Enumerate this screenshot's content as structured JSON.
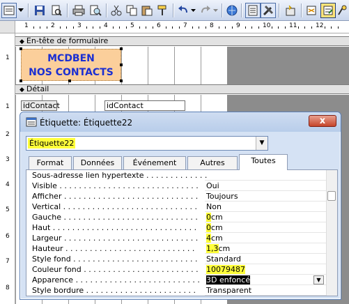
{
  "design_view": {
    "header_section_label": "En-tête de formulaire",
    "detail_section_label": "Détail",
    "header_label_line1": "MCDBEN",
    "header_label_line2": "NOS CONTACTS",
    "detail_label": "idContact",
    "detail_textbox": "idContact",
    "ruler_numbers": [
      "1",
      "2",
      "3",
      "4",
      "5",
      "6",
      "7",
      "8",
      "9",
      "10",
      "11",
      "12"
    ],
    "vruler_numbers": [
      "1",
      "1",
      "2",
      "3",
      "4",
      "5",
      "6",
      "7",
      "8"
    ]
  },
  "dialog": {
    "title": "Étiquette: Étiquette22",
    "close_label": "x",
    "selected_object": "Étiquette22",
    "tabs": [
      "Format",
      "Données",
      "Événement",
      "Autres",
      "Toutes"
    ],
    "active_tab": "Toutes",
    "properties": [
      {
        "name": "Sous-adresse lien hypertexte . . . . . . . . . . . . . . .",
        "value": ""
      },
      {
        "name": "Visible . . . . . . . . . . . . . . . . . . . . . . . . . . . . .",
        "value": "Oui"
      },
      {
        "name": "Afficher . . . . . . . . . . . . . . . . . . . . . . . . . . . .",
        "value": "Toujours"
      },
      {
        "name": "Vertical . . . . . . . . . . . . . . . . . . . . . . . . . . . .",
        "value": "Non"
      },
      {
        "name": "Gauche . . . . . . . . . . . . . . . . . . . . . . . . . . . .",
        "value": "0cm",
        "hl": "0"
      },
      {
        "name": "Haut . . . . . . . . . . . . . . . . . . . . . . . . . . . . . .",
        "value": "0cm",
        "hl": "0"
      },
      {
        "name": "Largeur . . . . . . . . . . . . . . . . . . . . . . . . . . . .",
        "value": "4cm",
        "hl": "4"
      },
      {
        "name": "Hauteur . . . . . . . . . . . . . . . . . . . . . . . . . . .",
        "value": "1,3cm",
        "hl": "1,3"
      },
      {
        "name": "Style fond . . . . . . . . . . . . . . . . . . . . . . . . . .",
        "value": "Standard"
      },
      {
        "name": "Couleur fond . . . . . . . . . . . . . . . . . . . . . . . .",
        "value": "10079487",
        "hl": "10079487"
      },
      {
        "name": "Apparence . . . . . . . . . . . . . . . . . . . . . . . . . .",
        "value": "3D enfoncé",
        "selected": true
      },
      {
        "name": "Style bordure . . . . . . . . . . . . . . . . . . . . . . .",
        "value": "Transparent"
      }
    ]
  },
  "colors": {
    "highlight": "#ffff3a",
    "label_bg": "#fbcf9b",
    "label_text": "#1b2fd2"
  },
  "toolbar_icons": [
    "form-view-icon",
    "save-icon",
    "search-file-icon",
    "print-icon",
    "print-preview-icon",
    "cut-icon",
    "copy-icon",
    "paste-icon",
    "format-painter-icon",
    "undo-icon",
    "redo-icon",
    "hyperlink-icon",
    "field-list-icon",
    "toolbox-icon",
    "autoformat-icon",
    "properties-icon",
    "build-icon"
  ]
}
